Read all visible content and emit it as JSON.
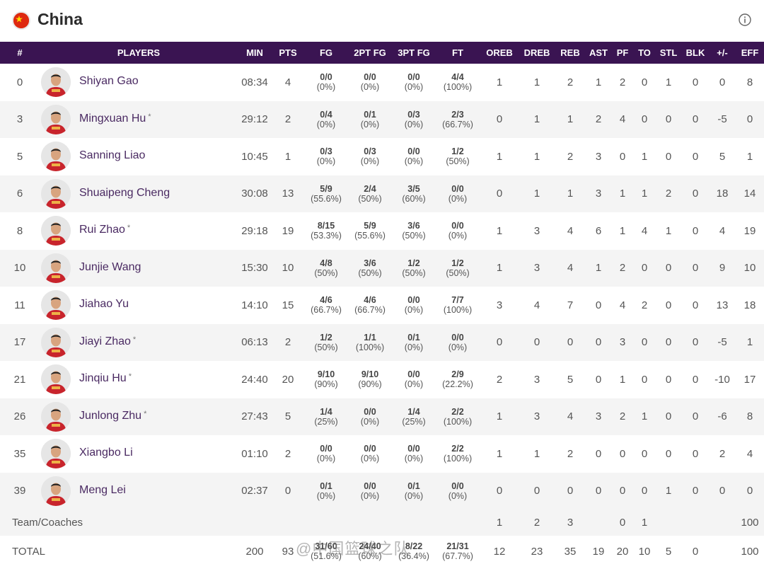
{
  "team": {
    "name": "China",
    "flag_icon": "china-flag-icon",
    "info_icon": "info-icon"
  },
  "columns": [
    "#",
    "PLAYERS",
    "MIN",
    "PTS",
    "FG",
    "2PT FG",
    "3PT FG",
    "FT",
    "OREB",
    "DREB",
    "REB",
    "AST",
    "PF",
    "TO",
    "STL",
    "BLK",
    "+/-",
    "EFF"
  ],
  "players": [
    {
      "no": "0",
      "name": "Shiyan Gao",
      "star": "",
      "min": "08:34",
      "pts": "4",
      "fg": "0/0",
      "fg_pct": "(0%)",
      "two": "0/0",
      "two_pct": "(0%)",
      "three": "0/0",
      "three_pct": "(0%)",
      "ft": "4/4",
      "ft_pct": "(100%)",
      "oreb": "1",
      "dreb": "1",
      "reb": "2",
      "ast": "1",
      "pf": "2",
      "to": "0",
      "stl": "1",
      "blk": "0",
      "pm": "0",
      "eff": "8"
    },
    {
      "no": "3",
      "name": "Mingxuan Hu",
      "star": "*",
      "min": "29:12",
      "pts": "2",
      "fg": "0/4",
      "fg_pct": "(0%)",
      "two": "0/1",
      "two_pct": "(0%)",
      "three": "0/3",
      "three_pct": "(0%)",
      "ft": "2/3",
      "ft_pct": "(66.7%)",
      "oreb": "0",
      "dreb": "1",
      "reb": "1",
      "ast": "2",
      "pf": "4",
      "to": "0",
      "stl": "0",
      "blk": "0",
      "pm": "-5",
      "eff": "0"
    },
    {
      "no": "5",
      "name": "Sanning Liao",
      "star": "",
      "min": "10:45",
      "pts": "1",
      "fg": "0/3",
      "fg_pct": "(0%)",
      "two": "0/3",
      "two_pct": "(0%)",
      "three": "0/0",
      "three_pct": "(0%)",
      "ft": "1/2",
      "ft_pct": "(50%)",
      "oreb": "1",
      "dreb": "1",
      "reb": "2",
      "ast": "3",
      "pf": "0",
      "to": "1",
      "stl": "0",
      "blk": "0",
      "pm": "5",
      "eff": "1"
    },
    {
      "no": "6",
      "name": "Shuaipeng Cheng",
      "star": "",
      "min": "30:08",
      "pts": "13",
      "fg": "5/9",
      "fg_pct": "(55.6%)",
      "two": "2/4",
      "two_pct": "(50%)",
      "three": "3/5",
      "three_pct": "(60%)",
      "ft": "0/0",
      "ft_pct": "(0%)",
      "oreb": "0",
      "dreb": "1",
      "reb": "1",
      "ast": "3",
      "pf": "1",
      "to": "1",
      "stl": "2",
      "blk": "0",
      "pm": "18",
      "eff": "14"
    },
    {
      "no": "8",
      "name": "Rui Zhao",
      "star": "*",
      "min": "29:18",
      "pts": "19",
      "fg": "8/15",
      "fg_pct": "(53.3%)",
      "two": "5/9",
      "two_pct": "(55.6%)",
      "three": "3/6",
      "three_pct": "(50%)",
      "ft": "0/0",
      "ft_pct": "(0%)",
      "oreb": "1",
      "dreb": "3",
      "reb": "4",
      "ast": "6",
      "pf": "1",
      "to": "4",
      "stl": "1",
      "blk": "0",
      "pm": "4",
      "eff": "19"
    },
    {
      "no": "10",
      "name": "Junjie Wang",
      "star": "",
      "min": "15:30",
      "pts": "10",
      "fg": "4/8",
      "fg_pct": "(50%)",
      "two": "3/6",
      "two_pct": "(50%)",
      "three": "1/2",
      "three_pct": "(50%)",
      "ft": "1/2",
      "ft_pct": "(50%)",
      "oreb": "1",
      "dreb": "3",
      "reb": "4",
      "ast": "1",
      "pf": "2",
      "to": "0",
      "stl": "0",
      "blk": "0",
      "pm": "9",
      "eff": "10"
    },
    {
      "no": "11",
      "name": "Jiahao Yu",
      "star": "",
      "min": "14:10",
      "pts": "15",
      "fg": "4/6",
      "fg_pct": "(66.7%)",
      "two": "4/6",
      "two_pct": "(66.7%)",
      "three": "0/0",
      "three_pct": "(0%)",
      "ft": "7/7",
      "ft_pct": "(100%)",
      "oreb": "3",
      "dreb": "4",
      "reb": "7",
      "ast": "0",
      "pf": "4",
      "to": "2",
      "stl": "0",
      "blk": "0",
      "pm": "13",
      "eff": "18"
    },
    {
      "no": "17",
      "name": "Jiayi Zhao",
      "star": "*",
      "min": "06:13",
      "pts": "2",
      "fg": "1/2",
      "fg_pct": "(50%)",
      "two": "1/1",
      "two_pct": "(100%)",
      "three": "0/1",
      "three_pct": "(0%)",
      "ft": "0/0",
      "ft_pct": "(0%)",
      "oreb": "0",
      "dreb": "0",
      "reb": "0",
      "ast": "0",
      "pf": "3",
      "to": "0",
      "stl": "0",
      "blk": "0",
      "pm": "-5",
      "eff": "1"
    },
    {
      "no": "21",
      "name": "Jinqiu Hu",
      "star": "*",
      "min": "24:40",
      "pts": "20",
      "fg": "9/10",
      "fg_pct": "(90%)",
      "two": "9/10",
      "two_pct": "(90%)",
      "three": "0/0",
      "three_pct": "(0%)",
      "ft": "2/9",
      "ft_pct": "(22.2%)",
      "oreb": "2",
      "dreb": "3",
      "reb": "5",
      "ast": "0",
      "pf": "1",
      "to": "0",
      "stl": "0",
      "blk": "0",
      "pm": "-10",
      "eff": "17"
    },
    {
      "no": "26",
      "name": "Junlong Zhu",
      "star": "*",
      "min": "27:43",
      "pts": "5",
      "fg": "1/4",
      "fg_pct": "(25%)",
      "two": "0/0",
      "two_pct": "(0%)",
      "three": "1/4",
      "three_pct": "(25%)",
      "ft": "2/2",
      "ft_pct": "(100%)",
      "oreb": "1",
      "dreb": "3",
      "reb": "4",
      "ast": "3",
      "pf": "2",
      "to": "1",
      "stl": "0",
      "blk": "0",
      "pm": "-6",
      "eff": "8"
    },
    {
      "no": "35",
      "name": "Xiangbo Li",
      "star": "",
      "min": "01:10",
      "pts": "2",
      "fg": "0/0",
      "fg_pct": "(0%)",
      "two": "0/0",
      "two_pct": "(0%)",
      "three": "0/0",
      "three_pct": "(0%)",
      "ft": "2/2",
      "ft_pct": "(100%)",
      "oreb": "1",
      "dreb": "1",
      "reb": "2",
      "ast": "0",
      "pf": "0",
      "to": "0",
      "stl": "0",
      "blk": "0",
      "pm": "2",
      "eff": "4"
    },
    {
      "no": "39",
      "name": "Meng Lei",
      "star": "",
      "min": "02:37",
      "pts": "0",
      "fg": "0/1",
      "fg_pct": "(0%)",
      "two": "0/0",
      "two_pct": "(0%)",
      "three": "0/1",
      "three_pct": "(0%)",
      "ft": "0/0",
      "ft_pct": "(0%)",
      "oreb": "0",
      "dreb": "0",
      "reb": "0",
      "ast": "0",
      "pf": "0",
      "to": "0",
      "stl": "1",
      "blk": "0",
      "pm": "0",
      "eff": "0"
    }
  ],
  "team_row": {
    "label": "Team/Coaches",
    "oreb": "1",
    "dreb": "2",
    "reb": "3",
    "pf": "0",
    "to": "1",
    "eff": "100"
  },
  "total_row": {
    "label": "TOTAL",
    "min": "200",
    "pts": "93",
    "fg": "31/60",
    "fg_pct": "(51.6%)",
    "two": "24/40",
    "two_pct": "(60%)",
    "three": "8/22",
    "three_pct": "(36.4%)",
    "ft": "21/31",
    "ft_pct": "(67.7%)",
    "oreb": "12",
    "dreb": "23",
    "reb": "35",
    "ast": "19",
    "pf": "20",
    "to": "10",
    "stl": "5",
    "blk": "0",
    "eff": "100"
  },
  "watermark": "@中国篮球之队"
}
